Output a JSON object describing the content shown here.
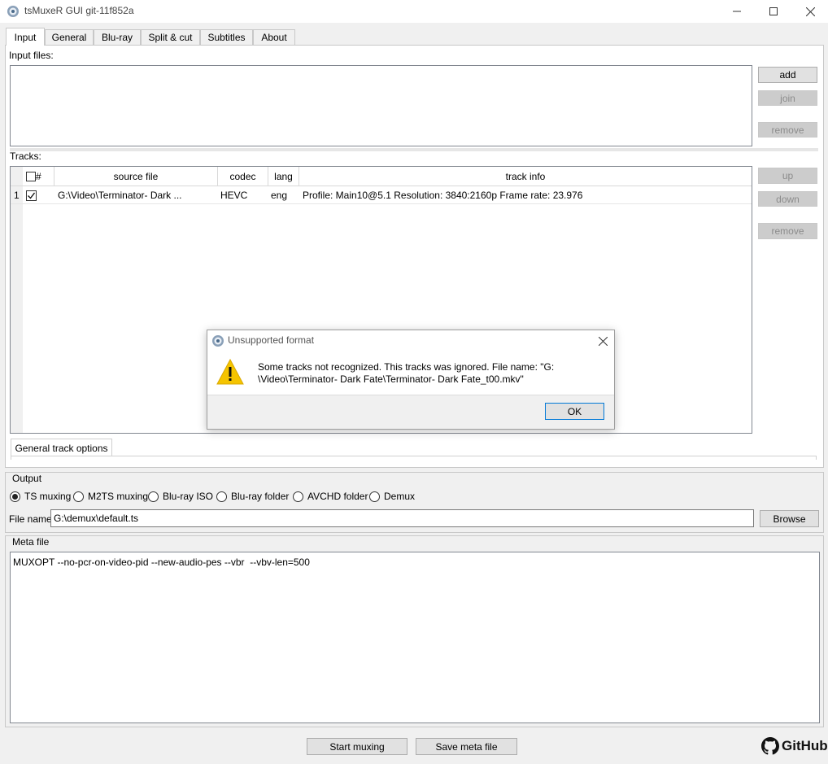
{
  "window": {
    "title": "tsMuxeR GUI git-11f852a"
  },
  "tabs": [
    {
      "label": "Input",
      "active": true
    },
    {
      "label": "General"
    },
    {
      "label": "Blu-ray"
    },
    {
      "label": "Split & cut"
    },
    {
      "label": "Subtitles"
    },
    {
      "label": "About"
    }
  ],
  "input_files": {
    "label": "Input files:",
    "buttons": {
      "add": "add",
      "join": "join",
      "remove": "remove"
    }
  },
  "tracks": {
    "label": "Tracks:",
    "columns": {
      "num": "#",
      "source_file": "source file",
      "codec": "codec",
      "lang": "lang",
      "track_info": "track info"
    },
    "rows": [
      {
        "num": "1",
        "checked": true,
        "source_file": "G:\\Video\\Terminator- Dark ...",
        "codec": "HEVC",
        "lang": "eng",
        "track_info": "Profile: Main10@5.1 Resolution: 3840:2160p  Frame rate: 23.976"
      }
    ],
    "buttons": {
      "up": "up",
      "down": "down",
      "remove": "remove"
    }
  },
  "track_options_tab": "General track options",
  "output": {
    "label": "Output",
    "modes": [
      {
        "label": "TS muxing",
        "selected": true
      },
      {
        "label": "M2TS muxing"
      },
      {
        "label": "Blu-ray ISO"
      },
      {
        "label": "Blu-ray folder"
      },
      {
        "label": "AVCHD folder"
      },
      {
        "label": "Demux"
      }
    ],
    "file_name_label": "File name",
    "file_name_value": "G:\\demux\\default.ts",
    "browse": "Browse"
  },
  "meta": {
    "label": "Meta file",
    "content": "MUXOPT --no-pcr-on-video-pid --new-audio-pes --vbr  --vbv-len=500"
  },
  "actions": {
    "start": "Start muxing",
    "save": "Save meta file"
  },
  "branding": {
    "github": "GitHub"
  },
  "dialog": {
    "title": "Unsupported format",
    "message_line1": "Some tracks not recognized. This tracks was ignored. File name: \"G:",
    "message_line2": "\\Video\\Terminator- Dark Fate\\Terminator- Dark Fate_t00.mkv\"",
    "ok": "OK"
  },
  "colors": {
    "warning": "#f5c400",
    "selection_border": "#0078d7"
  }
}
